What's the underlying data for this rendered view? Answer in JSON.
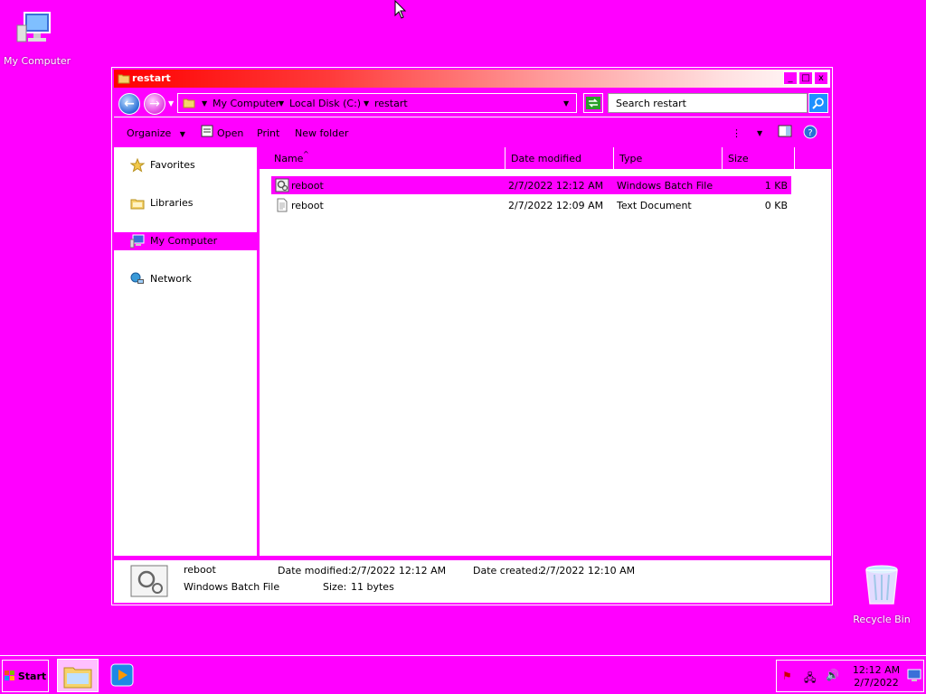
{
  "desktop": {
    "my_computer_label": "My Computer",
    "recycle_bin_label": "Recycle Bin"
  },
  "window": {
    "title": "restart",
    "controls": {
      "minimize": "_",
      "maximize": "□",
      "close": "x"
    }
  },
  "address": {
    "crumbs": [
      "My Computer",
      "Local Disk (C:)",
      "restart"
    ],
    "search_placeholder": "Search restart"
  },
  "toolbar": {
    "organize": "Organize",
    "open": "Open",
    "print": "Print",
    "new_folder": "New folder"
  },
  "navigation": {
    "items": [
      {
        "label": "Favorites",
        "icon": "star-icon"
      },
      {
        "label": "Libraries",
        "icon": "libraries-icon"
      },
      {
        "label": "My Computer",
        "icon": "computer-icon",
        "selected": true
      },
      {
        "label": "Network",
        "icon": "network-icon"
      }
    ]
  },
  "filelist": {
    "columns": [
      "Name",
      "Date modified",
      "Type",
      "Size"
    ],
    "rows": [
      {
        "name": "reboot",
        "date": "2/7/2022 12:12 AM",
        "type": "Windows Batch File",
        "size": "1 KB",
        "icon": "batch-file-icon",
        "selected": true
      },
      {
        "name": "reboot",
        "date": "2/7/2022 12:09 AM",
        "type": "Text Document",
        "size": "0 KB",
        "icon": "text-file-icon",
        "selected": false
      }
    ]
  },
  "details": {
    "name": "reboot",
    "type": "Windows Batch File",
    "date_modified_label": "Date modified:",
    "date_modified": "2/7/2022 12:12 AM",
    "date_created_label": "Date created:",
    "date_created": "2/7/2022 12:10 AM",
    "size_label": "Size:",
    "size": "11 bytes"
  },
  "taskbar": {
    "start_label": "Start",
    "time": "12:12 AM",
    "date": "2/7/2022"
  },
  "colors": {
    "background": "#ff00ff",
    "selection": "#ff00ff",
    "title_gradient_start": "#ff0000"
  }
}
